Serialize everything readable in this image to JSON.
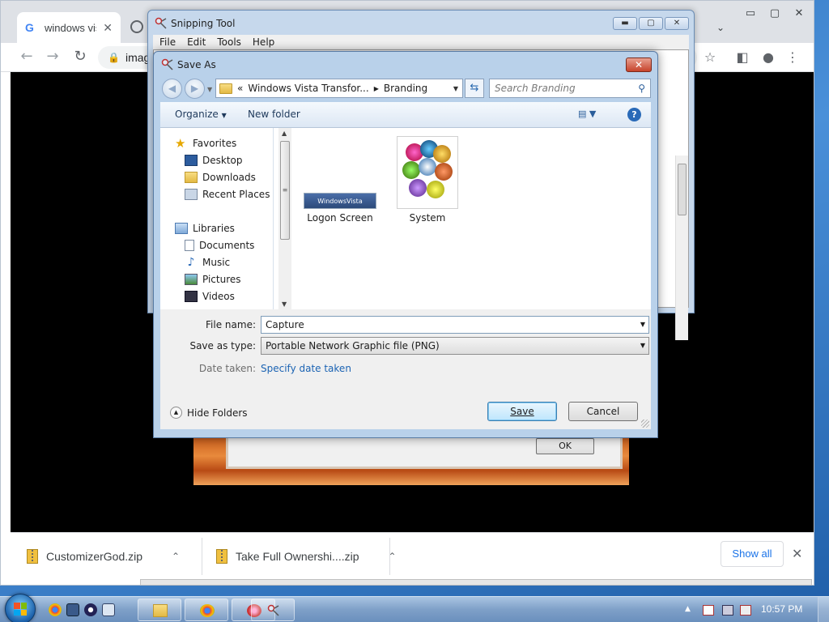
{
  "chrome": {
    "tab_title": "windows vis",
    "omnibox_text": "imag",
    "downloads": [
      {
        "name": "CustomizerGod.zip"
      },
      {
        "name": "Take Full Ownershi....zip"
      }
    ],
    "show_all_label": "Show all"
  },
  "background_dialog": {
    "ok_label": "OK"
  },
  "snipping_tool": {
    "title": "Snipping Tool",
    "menu": [
      "File",
      "Edit",
      "Tools",
      "Help"
    ]
  },
  "save_as": {
    "title": "Save As",
    "address": {
      "prefix": "«",
      "crumbs": [
        "Windows Vista Transfor...",
        "Branding"
      ]
    },
    "search_placeholder": "Search Branding",
    "commands": {
      "organize": "Organize",
      "new_folder": "New folder"
    },
    "nav": {
      "favorites_header": "Favorites",
      "favorites": [
        "Desktop",
        "Downloads",
        "Recent Places"
      ],
      "libraries_header": "Libraries",
      "libraries": [
        "Documents",
        "Music",
        "Pictures",
        "Videos"
      ]
    },
    "files": [
      {
        "name": "Logon Screen",
        "thumb_text": "WindowsVista ultimate"
      },
      {
        "name": "System"
      }
    ],
    "form": {
      "file_name_label": "File name:",
      "file_name_value": "Capture",
      "save_type_label": "Save as type:",
      "save_type_value": "Portable Network Graphic file (PNG)",
      "date_taken_label": "Date taken:",
      "date_taken_link": "Specify date taken",
      "hide_folders": "Hide Folders",
      "save": "Save",
      "cancel": "Cancel"
    }
  },
  "taskbar": {
    "time": "10:57 PM"
  },
  "colors": {
    "title_bar": "#b9d1ea",
    "link": "#1b63b3",
    "close_red": "#c7432b",
    "chrome_accent": "#1a73e8"
  }
}
